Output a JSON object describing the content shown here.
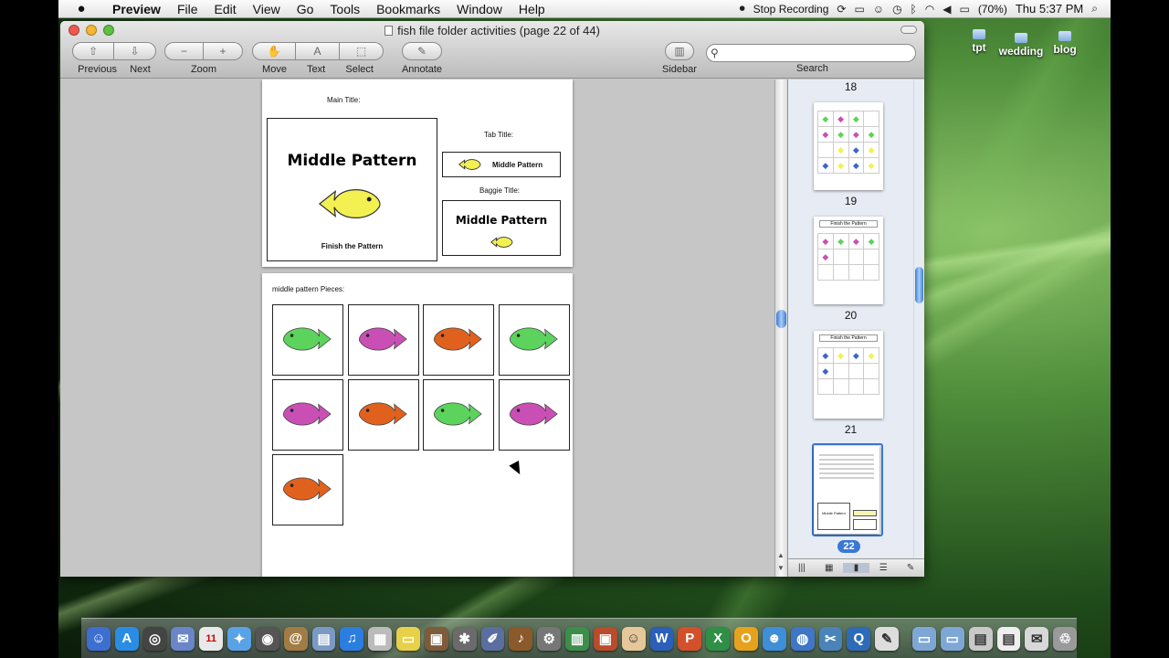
{
  "menubar": {
    "app_name": "Preview",
    "items": [
      "File",
      "Edit",
      "View",
      "Go",
      "Tools",
      "Bookmarks",
      "Window",
      "Help"
    ],
    "recording_label": "Stop Recording",
    "battery": "(70%)",
    "clock": "Thu 5:37 PM"
  },
  "desktop_icons": [
    {
      "label": "tpt"
    },
    {
      "label": "wedding"
    },
    {
      "label": "blog"
    }
  ],
  "window": {
    "title": "fish file folder activities (page 22 of 44)",
    "toolbar": {
      "previous": "Previous",
      "next": "Next",
      "zoom": "Zoom",
      "move": "Move",
      "text": "Text",
      "select": "Select",
      "annotate": "Annotate",
      "sidebar": "Sidebar",
      "search": "Search",
      "search_value": ""
    }
  },
  "document": {
    "page_top": {
      "main_title_label": "Main Title:",
      "main_card_title": "Middle Pattern",
      "main_card_caption": "Finish the Pattern",
      "tab_title_label": "Tab Title:",
      "tab_text": "Middle Pattern",
      "baggie_title_label": "Baggie Title:",
      "baggie_text": "Middle Pattern"
    },
    "page_bottom": {
      "pieces_label": "middle pattern Pieces:",
      "pieces": [
        "green",
        "magenta",
        "orange",
        "green",
        "magenta",
        "orange",
        "green",
        "magenta",
        "orange"
      ]
    }
  },
  "sidebar": {
    "page_numbers": [
      "18",
      "19",
      "20",
      "21",
      "22"
    ],
    "selected_page": "22",
    "thumb_header": "Finish the Pattern",
    "thumb_mini_title": "Middle Pattern"
  },
  "colors": {
    "green": "#5cd35c",
    "magenta": "#c94fb5",
    "orange": "#e0611d",
    "yellow": "#f3f052",
    "blue": "#3c66c6",
    "selection": "#3a78d8"
  }
}
